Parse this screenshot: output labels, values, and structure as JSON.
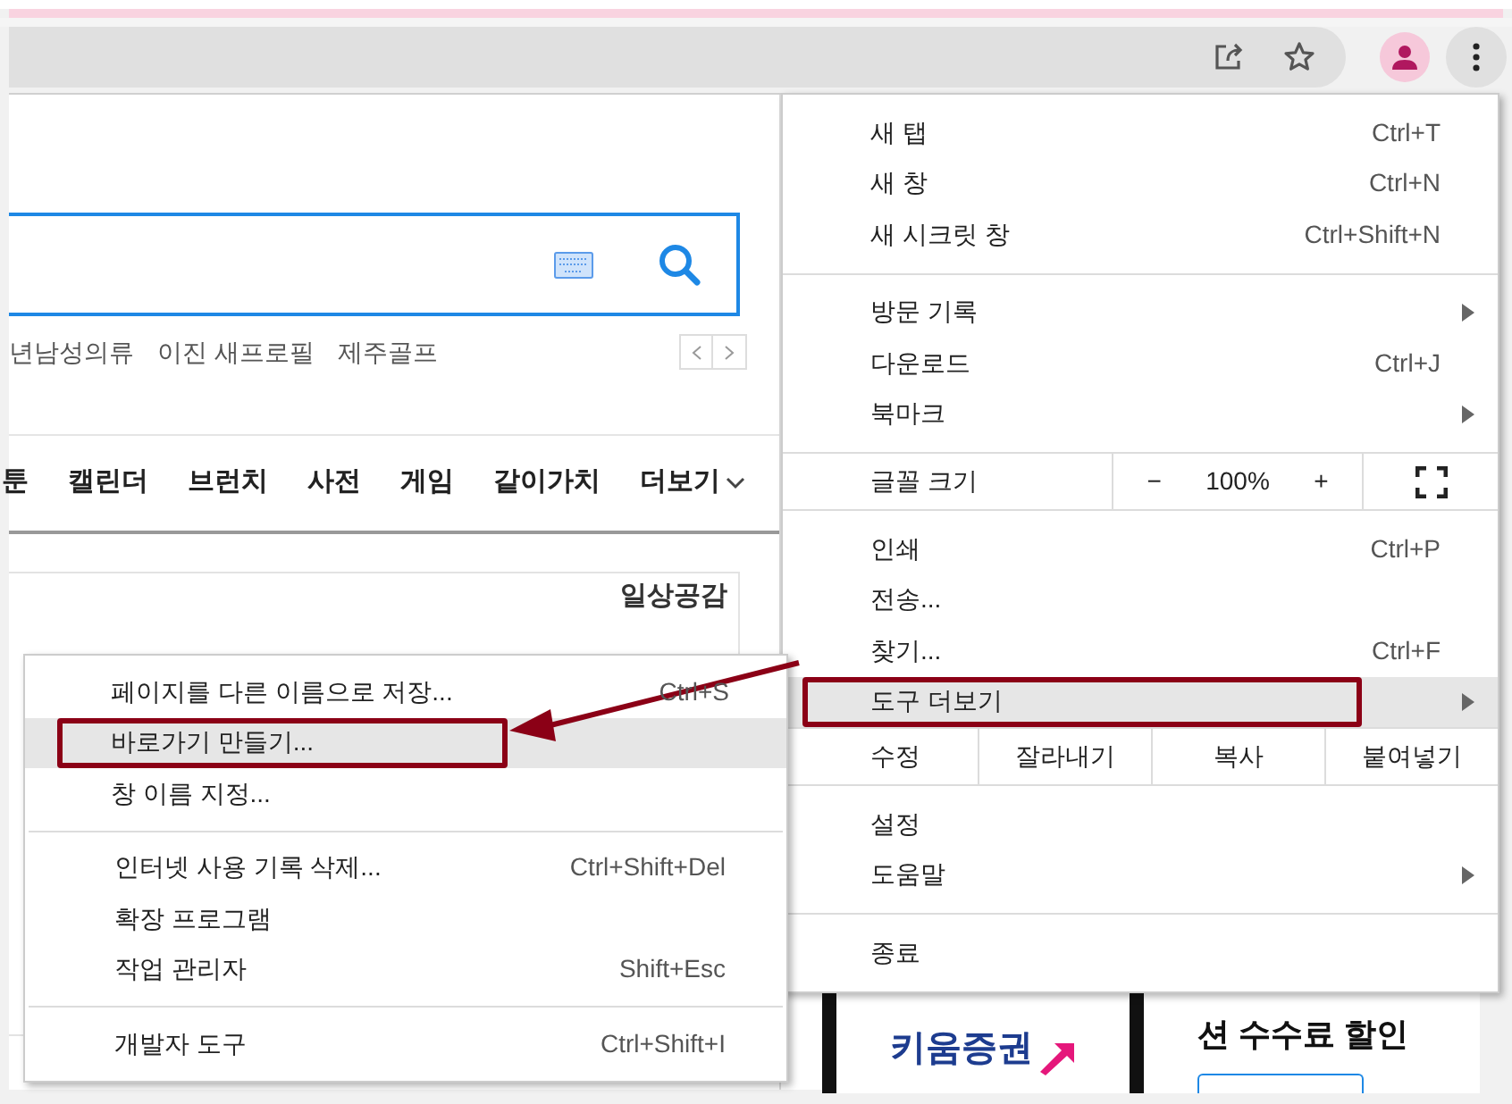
{
  "page": {
    "search_tags": [
      "년남성의류",
      "이진 새프로필",
      "제주골프"
    ],
    "nav": [
      {
        "label": "툰"
      },
      {
        "label": "캘린더"
      },
      {
        "label": "브런치"
      },
      {
        "label": "사전"
      },
      {
        "label": "게임"
      },
      {
        "label": "같이가치"
      },
      {
        "label": "더보기",
        "dropdown": true
      }
    ],
    "banner_tag": "일상공감",
    "ad": {
      "logo": "키움증권",
      "headline": "션 수수료 할인"
    }
  },
  "menu": {
    "sections": [
      [
        {
          "kind": "item",
          "label": "새 탭",
          "shortcut": "Ctrl+T",
          "submenu": false,
          "selected": false
        },
        {
          "kind": "item",
          "label": "새 창",
          "shortcut": "Ctrl+N",
          "submenu": false,
          "selected": false
        },
        {
          "kind": "item",
          "label": "새 시크릿 창",
          "shortcut": "Ctrl+Shift+N",
          "submenu": false,
          "selected": false
        }
      ],
      [
        {
          "kind": "item",
          "label": "방문 기록",
          "submenu": true,
          "selected": false
        },
        {
          "kind": "item",
          "label": "다운로드",
          "shortcut": "Ctrl+J",
          "submenu": false,
          "selected": false
        },
        {
          "kind": "item",
          "label": "북마크",
          "submenu": true,
          "selected": false
        }
      ],
      [
        {
          "kind": "zoom",
          "label": "글꼴 크기",
          "minus": "−",
          "value": "100%",
          "plus": "+"
        }
      ],
      [
        {
          "kind": "item",
          "label": "인쇄",
          "shortcut": "Ctrl+P",
          "submenu": false,
          "selected": false
        },
        {
          "kind": "item",
          "label": "전송...",
          "submenu": false,
          "selected": false
        },
        {
          "kind": "item",
          "label": "찾기...",
          "shortcut": "Ctrl+F",
          "submenu": false,
          "selected": false
        },
        {
          "kind": "item",
          "label": "도구 더보기",
          "submenu": true,
          "selected": true,
          "annotated": true
        }
      ],
      [
        {
          "kind": "edit",
          "label": "수정",
          "buttons": [
            "잘라내기",
            "복사",
            "붙여넣기"
          ]
        }
      ],
      [
        {
          "kind": "item",
          "label": "설정",
          "submenu": false,
          "selected": false
        },
        {
          "kind": "item",
          "label": "도움말",
          "submenu": true,
          "selected": false
        }
      ],
      [
        {
          "kind": "item",
          "label": "종료",
          "submenu": false,
          "selected": false
        }
      ]
    ]
  },
  "submenu": {
    "sections": [
      [
        {
          "label": "페이지를 다른 이름으로 저장...",
          "shortcut": "Ctrl+S",
          "selected": false
        },
        {
          "label": "바로가기 만들기...",
          "selected": true,
          "annotated": true
        },
        {
          "label": "창 이름 지정...",
          "selected": false
        }
      ],
      [
        {
          "label": "인터넷 사용 기록 삭제...",
          "shortcut": "Ctrl+Shift+Del",
          "selected": false
        },
        {
          "label": "확장 프로그램",
          "selected": false
        },
        {
          "label": "작업 관리자",
          "shortcut": "Shift+Esc",
          "selected": false
        }
      ],
      [
        {
          "label": "개발자 도구",
          "shortcut": "Ctrl+Shift+I",
          "selected": false
        }
      ]
    ]
  }
}
